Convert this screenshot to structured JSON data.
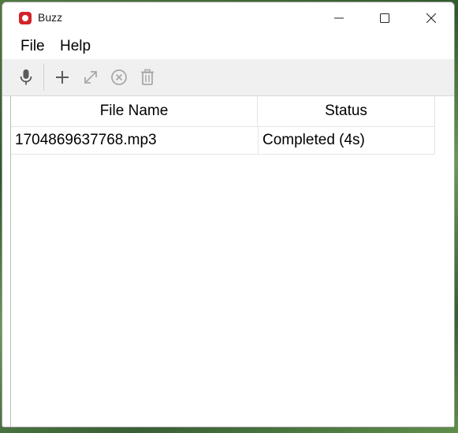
{
  "window": {
    "title": "Buzz"
  },
  "menubar": {
    "items": [
      {
        "label": "File"
      },
      {
        "label": "Help"
      }
    ]
  },
  "toolbar": {
    "buttons": [
      {
        "icon": "microphone-icon",
        "enabled": true
      },
      {
        "icon": "plus-icon",
        "enabled": true
      },
      {
        "icon": "expand-icon",
        "enabled": false
      },
      {
        "icon": "cancel-circle-icon",
        "enabled": false
      },
      {
        "icon": "trash-icon",
        "enabled": false
      }
    ]
  },
  "table": {
    "columns": [
      "File Name",
      "Status"
    ],
    "rows": [
      {
        "file_name": "1704869637768.mp3",
        "status": "Completed (4s)"
      }
    ]
  },
  "colors": {
    "logo": "#d4232a",
    "icon_enabled": "#5a5a5a",
    "icon_disabled": "#a8a8a8"
  }
}
